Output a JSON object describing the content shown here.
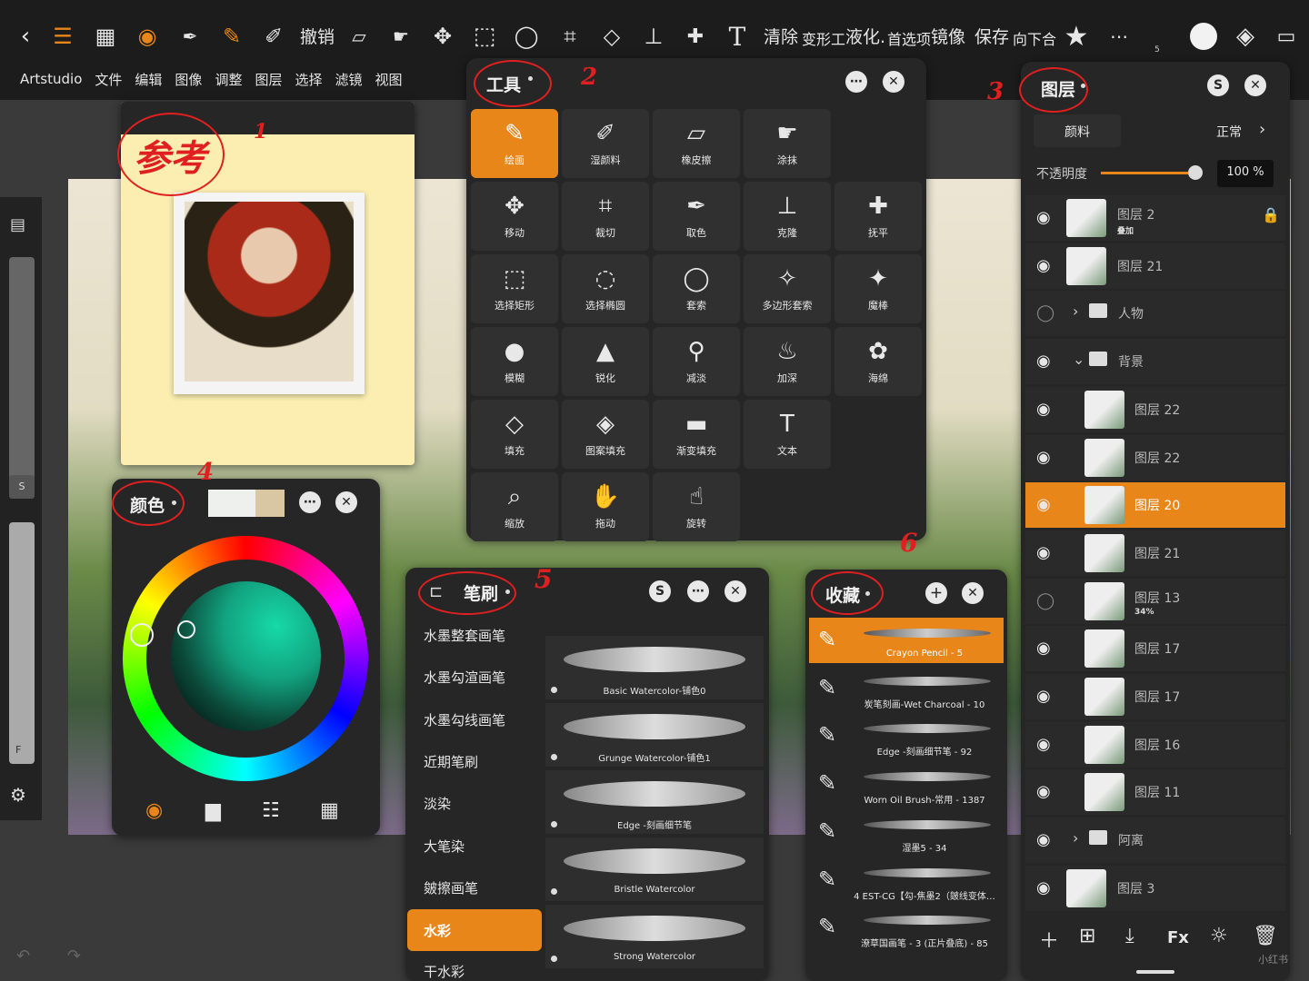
{
  "toolbar": {
    "undo_label": "撤销",
    "clear_label": "清除",
    "transform_label": "变形工",
    "liquify_label": "液化.",
    "prefs_label": "首选项",
    "mirror_label": "镜像",
    "save_label": "保存",
    "merge_label": "向下合",
    "layer_count": "5",
    "icons": [
      "back-icon",
      "menu-icon",
      "grid-icon",
      "pen-nib-icon",
      "eyedropper-icon",
      "brush-icon",
      "wet-brush-icon",
      "eraser-icon",
      "smudge-icon",
      "move-icon",
      "select-rect-icon",
      "lasso-icon",
      "crop-icon",
      "fill-icon",
      "stamp-icon",
      "heal-icon",
      "text-icon",
      "star-icon",
      "more-icon",
      "color-swatch-icon",
      "layers-icon",
      "fullscreen-icon"
    ]
  },
  "menu": {
    "items": [
      "Artstudio",
      "文件",
      "编辑",
      "图像",
      "调整",
      "图层",
      "选择",
      "滤镜",
      "视图"
    ]
  },
  "left_rail": {
    "size_label": "S",
    "flow_label": "F"
  },
  "reference_panel": {
    "annotation_text": "参考",
    "annotation_number": "1"
  },
  "tools_panel": {
    "title": "工具",
    "annotation_number": "2",
    "tools": [
      {
        "icon": "✎",
        "label": "绘画",
        "selected": true
      },
      {
        "icon": "✐",
        "label": "湿颜料"
      },
      {
        "icon": "▱",
        "label": "橡皮擦"
      },
      {
        "icon": "☛",
        "label": "涂抹"
      },
      {
        "icon": "",
        "label": "",
        "empty": true
      },
      {
        "icon": "✥",
        "label": "移动"
      },
      {
        "icon": "⌗",
        "label": "裁切"
      },
      {
        "icon": "✒",
        "label": "取色"
      },
      {
        "icon": "⊥",
        "label": "克隆"
      },
      {
        "icon": "✚",
        "label": "抚平"
      },
      {
        "icon": "⬚",
        "label": "选择矩形"
      },
      {
        "icon": "◌",
        "label": "选择椭圆"
      },
      {
        "icon": "◯",
        "label": "套索"
      },
      {
        "icon": "✧",
        "label": "多边形套索"
      },
      {
        "icon": "✦",
        "label": "魔棒"
      },
      {
        "icon": "●",
        "label": "模糊"
      },
      {
        "icon": "▲",
        "label": "锐化"
      },
      {
        "icon": "⚲",
        "label": "减淡"
      },
      {
        "icon": "♨",
        "label": "加深"
      },
      {
        "icon": "✿",
        "label": "海绵"
      },
      {
        "icon": "◇",
        "label": "填充"
      },
      {
        "icon": "◈",
        "label": "图案填充"
      },
      {
        "icon": "▬",
        "label": "渐变填充"
      },
      {
        "icon": "T",
        "label": "文本"
      },
      {
        "icon": "",
        "label": "",
        "empty": true
      },
      {
        "icon": "⌕",
        "label": "缩放"
      },
      {
        "icon": "✋",
        "label": "拖动"
      },
      {
        "icon": "☝",
        "label": "旋转"
      }
    ]
  },
  "layers_panel": {
    "title": "图层",
    "annotation_number": "3",
    "paint_label": "颜料",
    "blend_mode": "正常",
    "opacity_label": "不透明度",
    "opacity_value": "100 %",
    "opacity_fraction": 1.0,
    "rows": [
      {
        "name": "图层 2",
        "sub": "叠加",
        "visible": true,
        "locked": true,
        "indent": false
      },
      {
        "name": "图层 21",
        "visible": true,
        "indent": false
      },
      {
        "name": "人物",
        "visible": false,
        "folder": true,
        "expanded": false
      },
      {
        "name": "背景",
        "visible": true,
        "folder": true,
        "expanded": true
      },
      {
        "name": "图层 22",
        "visible": true,
        "indent": true
      },
      {
        "name": "图层 22",
        "visible": true,
        "indent": true
      },
      {
        "name": "图层 20",
        "visible": true,
        "indent": true,
        "selected": true
      },
      {
        "name": "图层 21",
        "visible": true,
        "indent": true
      },
      {
        "name": "图层 13",
        "sub": "34%",
        "visible": false,
        "indent": true
      },
      {
        "name": "图层 17",
        "visible": true,
        "indent": true
      },
      {
        "name": "图层 17",
        "visible": true,
        "indent": true
      },
      {
        "name": "图层 16",
        "visible": true,
        "indent": true
      },
      {
        "name": "图层 11",
        "visible": true,
        "indent": true
      },
      {
        "name": "阿离",
        "visible": true,
        "folder": true,
        "expanded": false
      },
      {
        "name": "图层 3",
        "visible": true,
        "indent": false
      }
    ],
    "bottom_fx_label": "Fx",
    "watermark": "小红书"
  },
  "color_panel": {
    "title": "颜色",
    "annotation_number": "4"
  },
  "brush_panel": {
    "title": "笔刷",
    "annotation_number": "5",
    "categories": [
      "水墨整套画笔",
      "水墨勾渲画笔",
      "水墨勾线画笔",
      "近期笔刷",
      "淡染",
      "大笔染",
      "皴擦画笔",
      "水彩",
      "干水彩"
    ],
    "selected_category": "水彩",
    "brushes": [
      "Basic Watercolor-铺色0",
      "Grunge Watercolor-铺色1",
      "Edge -刻画细节笔",
      "Bristle Watercolor",
      "Strong Watercolor"
    ]
  },
  "favorites_panel": {
    "title": "收藏",
    "annotation_number": "6",
    "items": [
      "Crayon Pencil - 5",
      "炭笔刻画-Wet Charcoal - 10",
      "Edge -刻画细节笔 - 92",
      "Worn Oil Brush-常用 - 1387",
      "湿墨5 - 34",
      "4 EST-CG【勾-焦墨2（皴线变体…",
      "潦草国画笔 - 3 (正片叠底) - 85"
    ]
  },
  "colors": {
    "accent": "#e8861a",
    "panel_bg": "#262626",
    "annotation_red": "#e02020"
  }
}
